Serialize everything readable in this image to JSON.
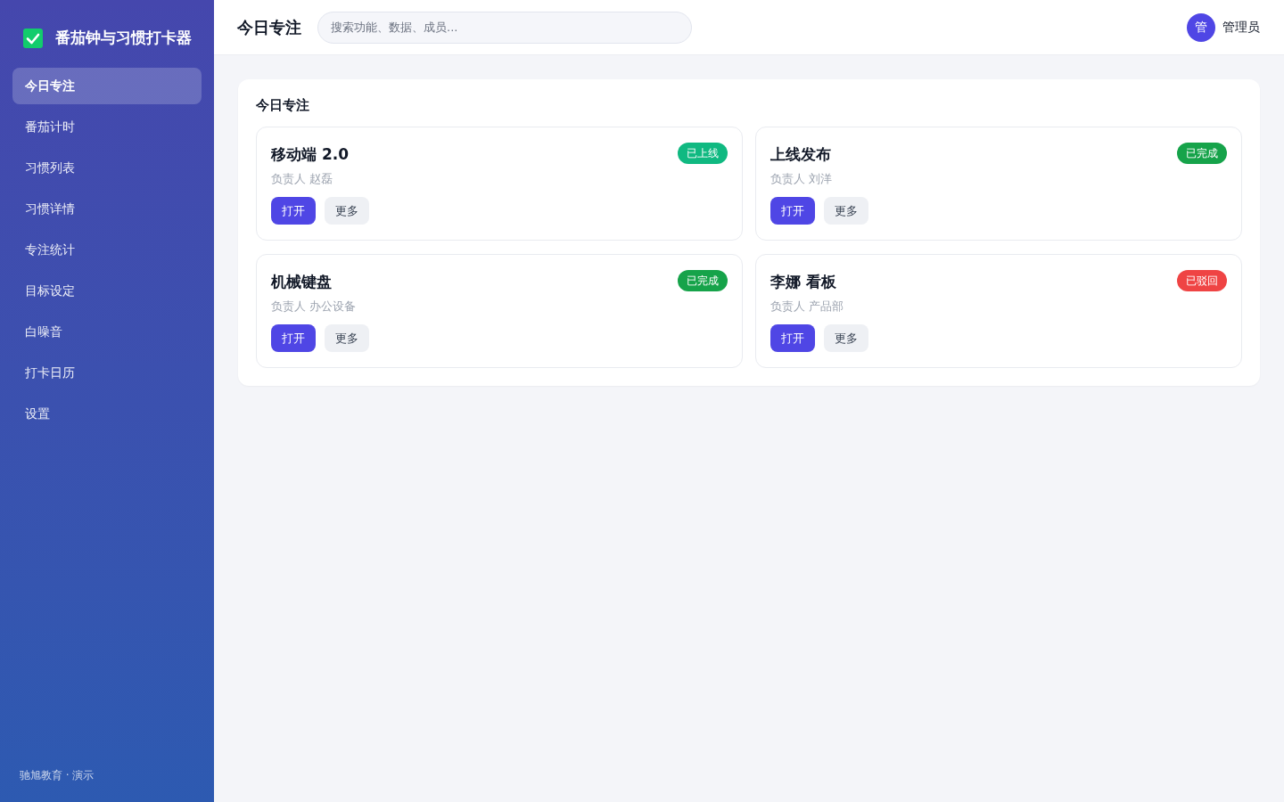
{
  "app": {
    "title": "番茄钟与习惯打卡器"
  },
  "sidebar": {
    "items": [
      {
        "label": "今日专注",
        "selected": true
      },
      {
        "label": "番茄计时",
        "selected": false
      },
      {
        "label": "习惯列表",
        "selected": false
      },
      {
        "label": "习惯详情",
        "selected": false
      },
      {
        "label": "专注统计",
        "selected": false
      },
      {
        "label": "目标设定",
        "selected": false
      },
      {
        "label": "白噪音",
        "selected": false
      },
      {
        "label": "打卡日历",
        "selected": false
      },
      {
        "label": "设置",
        "selected": false
      }
    ],
    "footer": "驰旭教育 · 演示"
  },
  "header": {
    "title": "今日专注",
    "search": {
      "placeholder": "搜索功能、数据、成员..."
    },
    "user": {
      "avatar": "管",
      "name": "管理员"
    }
  },
  "panel": {
    "title": "今日专注",
    "cards": [
      {
        "title": "移动端 2.0",
        "badge": {
          "label": "已上线",
          "color": "#10b981"
        },
        "owner": "负责人 赵磊",
        "buttons": [
          {
            "label": "打开",
            "kind": "primary"
          },
          {
            "label": "更多",
            "kind": "secondary"
          }
        ]
      },
      {
        "title": "上线发布",
        "badge": {
          "label": "已完成",
          "color": "#16a34a"
        },
        "owner": "负责人 刘洋",
        "buttons": [
          {
            "label": "打开",
            "kind": "primary"
          },
          {
            "label": "更多",
            "kind": "secondary"
          }
        ]
      },
      {
        "title": "机械键盘",
        "badge": {
          "label": "已完成",
          "color": "#16a34a"
        },
        "owner": "负责人 办公设备",
        "buttons": [
          {
            "label": "打开",
            "kind": "primary"
          },
          {
            "label": "更多",
            "kind": "secondary"
          }
        ]
      },
      {
        "title": "李娜 看板",
        "badge": {
          "label": "已驳回",
          "color": "#ef4444"
        },
        "owner": "负责人 产品部",
        "buttons": [
          {
            "label": "打开",
            "kind": "primary"
          },
          {
            "label": "更多",
            "kind": "secondary"
          }
        ]
      }
    ]
  }
}
